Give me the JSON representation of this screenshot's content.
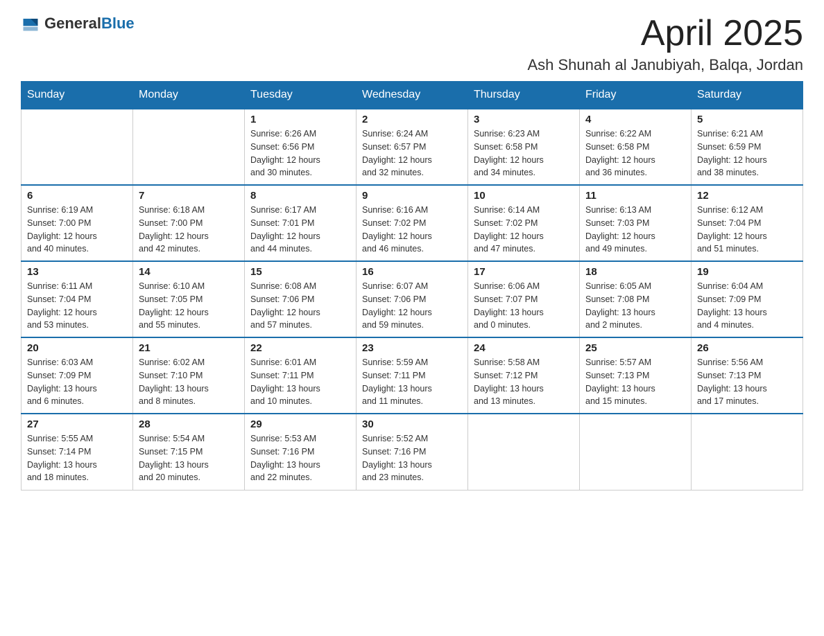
{
  "header": {
    "logo_general": "General",
    "logo_blue": "Blue",
    "month_year": "April 2025",
    "location": "Ash Shunah al Janubiyah, Balqa, Jordan"
  },
  "days_of_week": [
    "Sunday",
    "Monday",
    "Tuesday",
    "Wednesday",
    "Thursday",
    "Friday",
    "Saturday"
  ],
  "weeks": [
    [
      {
        "day": "",
        "info": ""
      },
      {
        "day": "",
        "info": ""
      },
      {
        "day": "1",
        "info": "Sunrise: 6:26 AM\nSunset: 6:56 PM\nDaylight: 12 hours\nand 30 minutes."
      },
      {
        "day": "2",
        "info": "Sunrise: 6:24 AM\nSunset: 6:57 PM\nDaylight: 12 hours\nand 32 minutes."
      },
      {
        "day": "3",
        "info": "Sunrise: 6:23 AM\nSunset: 6:58 PM\nDaylight: 12 hours\nand 34 minutes."
      },
      {
        "day": "4",
        "info": "Sunrise: 6:22 AM\nSunset: 6:58 PM\nDaylight: 12 hours\nand 36 minutes."
      },
      {
        "day": "5",
        "info": "Sunrise: 6:21 AM\nSunset: 6:59 PM\nDaylight: 12 hours\nand 38 minutes."
      }
    ],
    [
      {
        "day": "6",
        "info": "Sunrise: 6:19 AM\nSunset: 7:00 PM\nDaylight: 12 hours\nand 40 minutes."
      },
      {
        "day": "7",
        "info": "Sunrise: 6:18 AM\nSunset: 7:00 PM\nDaylight: 12 hours\nand 42 minutes."
      },
      {
        "day": "8",
        "info": "Sunrise: 6:17 AM\nSunset: 7:01 PM\nDaylight: 12 hours\nand 44 minutes."
      },
      {
        "day": "9",
        "info": "Sunrise: 6:16 AM\nSunset: 7:02 PM\nDaylight: 12 hours\nand 46 minutes."
      },
      {
        "day": "10",
        "info": "Sunrise: 6:14 AM\nSunset: 7:02 PM\nDaylight: 12 hours\nand 47 minutes."
      },
      {
        "day": "11",
        "info": "Sunrise: 6:13 AM\nSunset: 7:03 PM\nDaylight: 12 hours\nand 49 minutes."
      },
      {
        "day": "12",
        "info": "Sunrise: 6:12 AM\nSunset: 7:04 PM\nDaylight: 12 hours\nand 51 minutes."
      }
    ],
    [
      {
        "day": "13",
        "info": "Sunrise: 6:11 AM\nSunset: 7:04 PM\nDaylight: 12 hours\nand 53 minutes."
      },
      {
        "day": "14",
        "info": "Sunrise: 6:10 AM\nSunset: 7:05 PM\nDaylight: 12 hours\nand 55 minutes."
      },
      {
        "day": "15",
        "info": "Sunrise: 6:08 AM\nSunset: 7:06 PM\nDaylight: 12 hours\nand 57 minutes."
      },
      {
        "day": "16",
        "info": "Sunrise: 6:07 AM\nSunset: 7:06 PM\nDaylight: 12 hours\nand 59 minutes."
      },
      {
        "day": "17",
        "info": "Sunrise: 6:06 AM\nSunset: 7:07 PM\nDaylight: 13 hours\nand 0 minutes."
      },
      {
        "day": "18",
        "info": "Sunrise: 6:05 AM\nSunset: 7:08 PM\nDaylight: 13 hours\nand 2 minutes."
      },
      {
        "day": "19",
        "info": "Sunrise: 6:04 AM\nSunset: 7:09 PM\nDaylight: 13 hours\nand 4 minutes."
      }
    ],
    [
      {
        "day": "20",
        "info": "Sunrise: 6:03 AM\nSunset: 7:09 PM\nDaylight: 13 hours\nand 6 minutes."
      },
      {
        "day": "21",
        "info": "Sunrise: 6:02 AM\nSunset: 7:10 PM\nDaylight: 13 hours\nand 8 minutes."
      },
      {
        "day": "22",
        "info": "Sunrise: 6:01 AM\nSunset: 7:11 PM\nDaylight: 13 hours\nand 10 minutes."
      },
      {
        "day": "23",
        "info": "Sunrise: 5:59 AM\nSunset: 7:11 PM\nDaylight: 13 hours\nand 11 minutes."
      },
      {
        "day": "24",
        "info": "Sunrise: 5:58 AM\nSunset: 7:12 PM\nDaylight: 13 hours\nand 13 minutes."
      },
      {
        "day": "25",
        "info": "Sunrise: 5:57 AM\nSunset: 7:13 PM\nDaylight: 13 hours\nand 15 minutes."
      },
      {
        "day": "26",
        "info": "Sunrise: 5:56 AM\nSunset: 7:13 PM\nDaylight: 13 hours\nand 17 minutes."
      }
    ],
    [
      {
        "day": "27",
        "info": "Sunrise: 5:55 AM\nSunset: 7:14 PM\nDaylight: 13 hours\nand 18 minutes."
      },
      {
        "day": "28",
        "info": "Sunrise: 5:54 AM\nSunset: 7:15 PM\nDaylight: 13 hours\nand 20 minutes."
      },
      {
        "day": "29",
        "info": "Sunrise: 5:53 AM\nSunset: 7:16 PM\nDaylight: 13 hours\nand 22 minutes."
      },
      {
        "day": "30",
        "info": "Sunrise: 5:52 AM\nSunset: 7:16 PM\nDaylight: 13 hours\nand 23 minutes."
      },
      {
        "day": "",
        "info": ""
      },
      {
        "day": "",
        "info": ""
      },
      {
        "day": "",
        "info": ""
      }
    ]
  ]
}
